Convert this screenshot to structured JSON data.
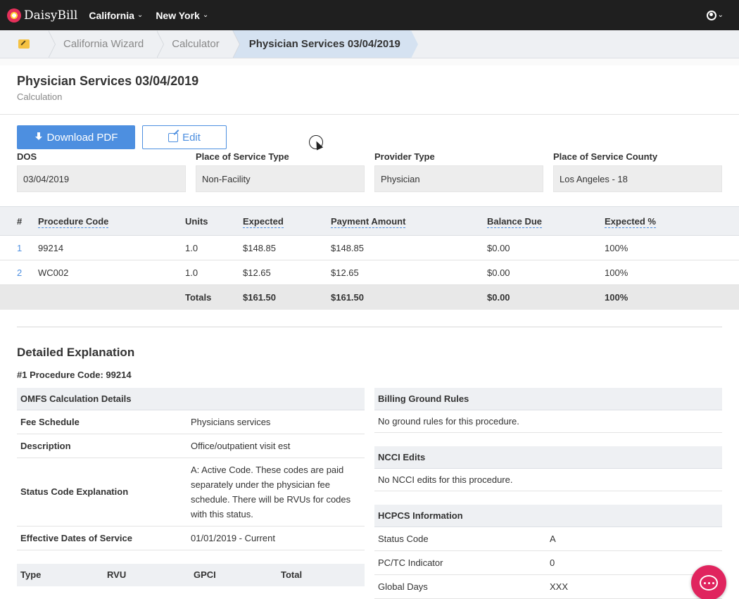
{
  "nav": {
    "brand": "DaisyBill",
    "items": [
      {
        "label": "California"
      },
      {
        "label": "New York"
      }
    ]
  },
  "breadcrumb": [
    "California Wizard",
    "Calculator",
    "Physician Services 03/04/2019"
  ],
  "page": {
    "title": "Physician Services 03/04/2019",
    "subtitle": "Calculation"
  },
  "actions": {
    "download_label": "Download PDF",
    "edit_label": "Edit"
  },
  "fields": [
    {
      "label": "DOS",
      "value": "03/04/2019"
    },
    {
      "label": "Place of Service Type",
      "value": "Non-Facility"
    },
    {
      "label": "Provider Type",
      "value": "Physician"
    },
    {
      "label": "Place of Service County",
      "value": "Los Angeles - 18"
    }
  ],
  "proc_table": {
    "headers": [
      "#",
      "Procedure Code",
      "Units",
      "Expected",
      "Payment Amount",
      "Balance Due",
      "Expected %"
    ],
    "rows": [
      [
        "1",
        "99214",
        "1.0",
        "$148.85",
        "$148.85",
        "$0.00",
        "100%"
      ],
      [
        "2",
        "WC002",
        "1.0",
        "$12.65",
        "$12.65",
        "$0.00",
        "100%"
      ]
    ],
    "totals": [
      "",
      "",
      "Totals",
      "$161.50",
      "$161.50",
      "$0.00",
      "100%"
    ]
  },
  "detail": {
    "title": "Detailed Explanation",
    "proc_line": "#1 Procedure Code: 99214",
    "omfs": {
      "head": "OMFS Calculation Details",
      "rows": [
        {
          "k": "Fee Schedule",
          "v": "Physicians services"
        },
        {
          "k": "Description",
          "v": "Office/outpatient visit est"
        },
        {
          "k": "Status Code Explanation",
          "v": "A: Active Code. These codes are paid separately under the physician fee schedule. There will be RVUs for codes with this status."
        },
        {
          "k": "Effective Dates of Service",
          "v": "01/01/2019 - Current"
        }
      ]
    },
    "rvu_headers": [
      "Type",
      "RVU",
      "GPCI",
      "Total"
    ],
    "billing": {
      "head": "Billing Ground Rules",
      "text": "No ground rules for this procedure."
    },
    "ncci": {
      "head": "NCCI Edits",
      "text": "No NCCI edits for this procedure."
    },
    "hcpcs": {
      "head": "HCPCS Information",
      "rows": [
        {
          "k": "Status Code",
          "v": "A"
        },
        {
          "k": "PC/TC Indicator",
          "v": "0"
        },
        {
          "k": "Global Days",
          "v": "XXX"
        }
      ]
    }
  }
}
